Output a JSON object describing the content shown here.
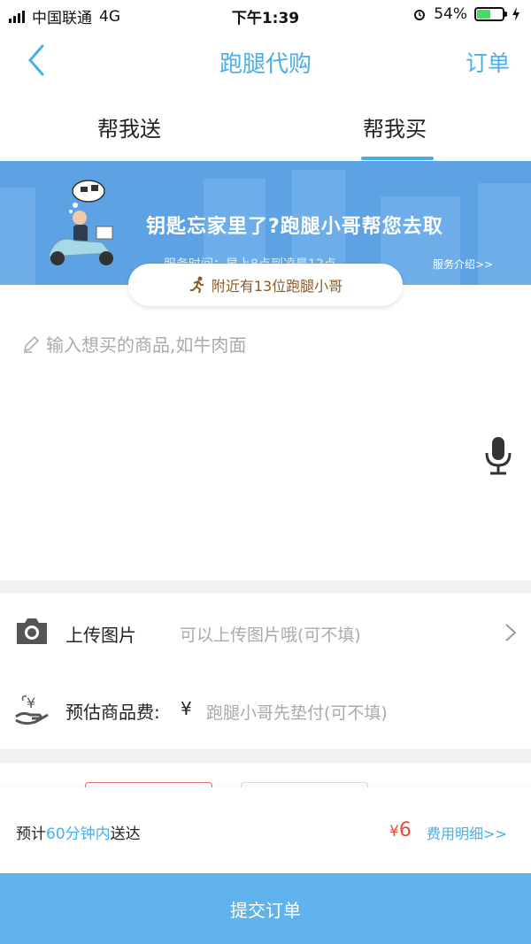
{
  "status_bar": {
    "carrier": "中国联通",
    "network": "4G",
    "time": "下午1:39",
    "battery": "54%",
    "battery_level": 0.54
  },
  "nav": {
    "title": "跑腿代购",
    "order_link": "订单"
  },
  "tabs": [
    {
      "label": "帮我送"
    },
    {
      "label": "帮我买",
      "active": true
    }
  ],
  "banner": {
    "headline": "钥匙忘家里了?跑腿小哥帮您去取",
    "service_time": "服务时间：早上8点到凌晨12点",
    "intro_link": "服务介绍>>"
  },
  "nearby": {
    "text": "附近有13位跑腿小哥"
  },
  "goods": {
    "placeholder": "输入想买的商品,如牛肉面"
  },
  "upload": {
    "label": "上传图片",
    "hint": "可以上传图片哦(可不填)"
  },
  "price_row": {
    "label": "预估商品费:",
    "currency": "¥",
    "hint": "跑腿小哥先垫付(可不填)"
  },
  "footer": {
    "eta_prefix": "预计",
    "eta_highlight": "60分钟内",
    "eta_suffix": "送达",
    "currency": "¥",
    "price": "6",
    "fee_detail": "费用明细>>"
  },
  "submit": {
    "label": "提交订单"
  },
  "colors": {
    "accent": "#4aaee8",
    "banner": "#5da2e3",
    "price": "#e74c3c",
    "submit": "#5fb3ea"
  },
  "icons": {
    "back": "chevron-left-icon",
    "camera": "camera-icon",
    "money": "money-hand-icon",
    "mic": "microphone-icon",
    "pencil": "pencil-icon",
    "runner": "runner-icon",
    "chevron": "chevron-right-icon"
  }
}
